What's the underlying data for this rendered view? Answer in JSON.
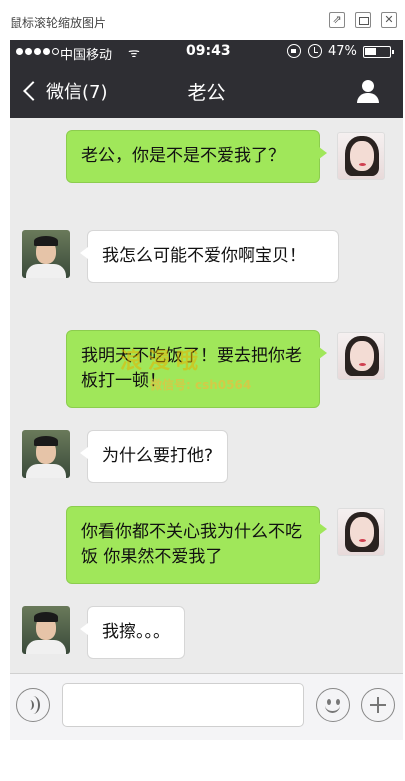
{
  "viewer": {
    "title": "鼠标滚轮缩放图片",
    "close_glyph": "✕",
    "popout_glyph": "⇗"
  },
  "status_bar": {
    "carrier": "中国移动",
    "wifi_glyph": "ᯤ",
    "time": "09:43",
    "battery_percent": "47%",
    "battery_level": 0.47
  },
  "nav": {
    "back_label": "微信(7)",
    "title": "老公"
  },
  "messages": [
    {
      "sender": "me",
      "text": "老公，你是不是不爱我了？"
    },
    {
      "sender": "him",
      "text": "我怎么可能不爱你啊宝贝！"
    },
    {
      "sender": "me",
      "text": "我明天不吃饭了！要去把你老板打一顿！"
    },
    {
      "sender": "him",
      "text": "为什么要打他?"
    },
    {
      "sender": "me",
      "text": "你看你都不关心我为什么不吃饭 你果然不爱我了"
    },
    {
      "sender": "him",
      "text": "我擦。。。"
    }
  ],
  "watermark": {
    "line1": "浪漫哦",
    "line2": "微信号: csh0564"
  },
  "colors": {
    "nav_bg": "#2e2e33",
    "chat_bg": "#ebebeb",
    "my_bubble": "#a0e75a",
    "their_bubble": "#ffffff"
  },
  "icons": {
    "voice": "voice-icon",
    "emoji": "emoji-icon",
    "plus": "plus-icon",
    "profile": "profile-icon"
  }
}
